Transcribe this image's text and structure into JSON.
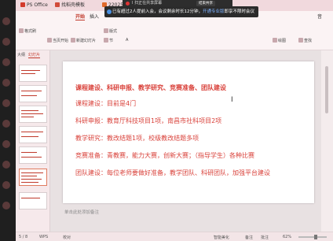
{
  "tabs": [
    {
      "label": "PS Office",
      "icon": "wps-icon",
      "color": "#d33a2c"
    },
    {
      "label": "找稻壳模板",
      "icon": "docer-icon",
      "color": "#d14b3a"
    },
    {
      "label": "22025-2026学年第二",
      "icon": "ppt-icon",
      "color": "#e06a2b"
    }
  ],
  "meeting": {
    "bar_text": "I 扫正在共享屏幕",
    "button_label": "结束共享"
  },
  "notice": {
    "text_prefix": "已有超过2人提前入会，会议剩余时长12分钟，",
    "link_text": "开通专业版",
    "text_suffix": "即享不限时会议"
  },
  "ribbon": {
    "menu_start": "开始",
    "menu_insert": "插入",
    "menu_end": "音",
    "tool_format_painter": "格式刷",
    "tool_from_current": "当页开始",
    "tool_new_slide": "新建幻灯片",
    "tool_layout": "版式",
    "tool_section": "节",
    "tool_draw": "绘图",
    "tool_find": "查找",
    "text_label": "A"
  },
  "subpanel": {
    "tab_outline": "大纲",
    "tab_slides": "幻灯片"
  },
  "slide": {
    "lines": [
      "课程建设、科研申报、教学研究、竞赛准备、团队建设",
      "课程建设：目前是4门",
      "科研申报：教育厅科技项目1项，南昌市社科项目2项",
      "教学研究：教改结题1项，校级教改结题多项",
      "竞赛准备：青教赛，能力大赛，创新大赛；（指导学生）各种比赛",
      "团队建设：每位老师要做好准备，教学团队、科研团队，加强平台建设"
    ],
    "text_color": "#d9413a",
    "cursor": "I"
  },
  "notes_placeholder": "单击此处添加备注",
  "status": {
    "page": "5 / 8",
    "app": "WPS",
    "proofing": "校对",
    "smart": "智能美化",
    "notes": "备注",
    "comments": "批注",
    "zoom": "62%",
    "zoom_level": 0.62
  }
}
